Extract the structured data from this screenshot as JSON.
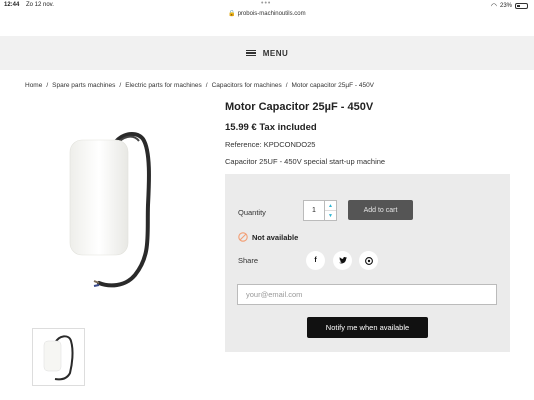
{
  "status_bar": {
    "time": "12:44",
    "date": "Zo 12 nov.",
    "url": "probois-machinoutils.com",
    "battery": "23%"
  },
  "nav": {
    "menu_label": "MENU"
  },
  "breadcrumb": [
    "Home",
    "Spare parts machines",
    "Electric parts for machines",
    "Capacitors for machines",
    "Motor capacitor 25µF - 450V"
  ],
  "product": {
    "title": "Motor Capacitor 25µF - 450V",
    "price": "15.99 € Tax included",
    "reference": "Reference: KPDCONDO25",
    "description": "Capacitor 25UF - 450V special start-up machine"
  },
  "purchase": {
    "quantity_label": "Quantity",
    "quantity_value": "1",
    "add_to_cart_label": "Add to cart",
    "availability": "Not available",
    "share_label": "Share",
    "social": [
      "f",
      "t",
      "p"
    ],
    "email_placeholder": "your@email.com",
    "notify_label": "Notify me when available"
  },
  "colors": {
    "unavailable_icon": "#f39d72",
    "spinner_arrow": "#2fb5d2",
    "add_button": "#555555",
    "notify_button": "#111111"
  }
}
